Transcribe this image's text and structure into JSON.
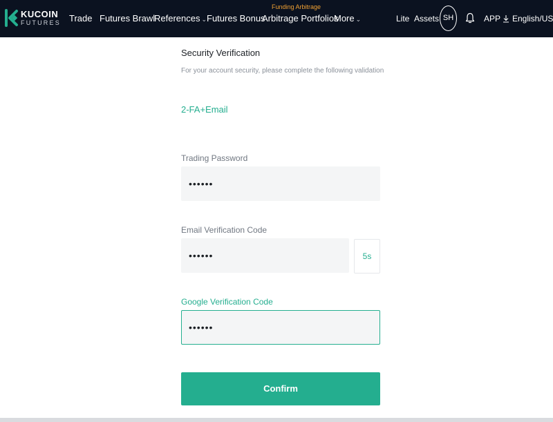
{
  "brand": {
    "name": "KUCOIN",
    "sub": "FUTURES",
    "accent": "#24ae8f",
    "header_bg": "#0b1220",
    "promo_color": "#f0a033"
  },
  "nav": {
    "trade": "Trade",
    "futures_brawl": "Futures Brawl",
    "references": "References",
    "futures_bonus": "Futures Bonus",
    "arbitrage_portfolios": "Arbitrage Portfolios",
    "arbitrage_badge": "Funding Arbitrage",
    "more": "More"
  },
  "nav_right": {
    "lite": "Lite",
    "assets": "Assets",
    "avatar": "SH",
    "app": "APP",
    "locale": "English/USD"
  },
  "icons": [
    "logo-icon",
    "chevron-down-icon",
    "bell-icon",
    "download-icon"
  ],
  "form": {
    "title": "Security Verification",
    "subtitle": "For your account security, please complete the following validation",
    "method": "2-FA+Email",
    "trading_password": {
      "label": "Trading Password",
      "value": "••••••"
    },
    "email_code": {
      "label": "Email Verification Code",
      "value": "••••••",
      "countdown": "5s"
    },
    "google_code": {
      "label": "Google Verification Code",
      "value": "••••••"
    },
    "confirm_label": "Confirm"
  }
}
